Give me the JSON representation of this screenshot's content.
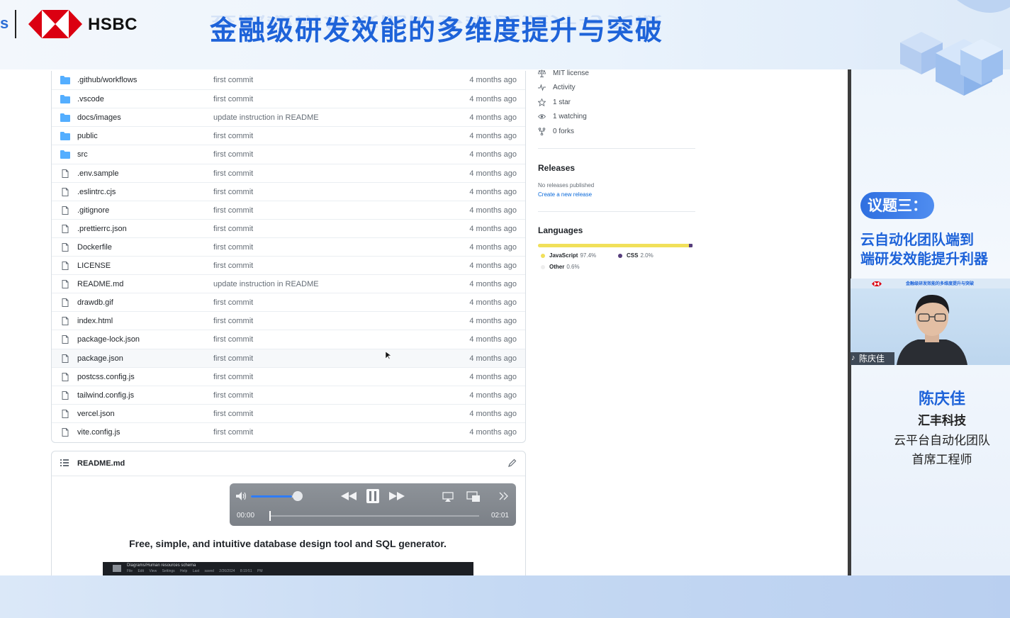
{
  "banner": {
    "edge_glyph": "s",
    "hsbc_name": "HSBC",
    "main_title": "金融级研发效能的多维度提升与突破"
  },
  "file_list": [
    {
      "type": "folder",
      "name": ".github/workflows",
      "message": "first commit",
      "date": "4 months ago"
    },
    {
      "type": "folder",
      "name": ".vscode",
      "message": "first commit",
      "date": "4 months ago"
    },
    {
      "type": "folder",
      "name": "docs/images",
      "message": "update instruction in README",
      "date": "4 months ago"
    },
    {
      "type": "folder",
      "name": "public",
      "message": "first commit",
      "date": "4 months ago"
    },
    {
      "type": "folder",
      "name": "src",
      "message": "first commit",
      "date": "4 months ago"
    },
    {
      "type": "file",
      "name": ".env.sample",
      "message": "first commit",
      "date": "4 months ago"
    },
    {
      "type": "file",
      "name": ".eslintrc.cjs",
      "message": "first commit",
      "date": "4 months ago"
    },
    {
      "type": "file",
      "name": ".gitignore",
      "message": "first commit",
      "date": "4 months ago"
    },
    {
      "type": "file",
      "name": ".prettierrc.json",
      "message": "first commit",
      "date": "4 months ago"
    },
    {
      "type": "file",
      "name": "Dockerfile",
      "message": "first commit",
      "date": "4 months ago"
    },
    {
      "type": "file",
      "name": "LICENSE",
      "message": "first commit",
      "date": "4 months ago"
    },
    {
      "type": "file",
      "name": "README.md",
      "message": "update instruction in README",
      "date": "4 months ago"
    },
    {
      "type": "file",
      "name": "drawdb.gif",
      "message": "first commit",
      "date": "4 months ago"
    },
    {
      "type": "file",
      "name": "index.html",
      "message": "first commit",
      "date": "4 months ago"
    },
    {
      "type": "file",
      "name": "package-lock.json",
      "message": "first commit",
      "date": "4 months ago"
    },
    {
      "type": "file",
      "name": "package.json",
      "message": "first commit",
      "date": "4 months ago"
    },
    {
      "type": "file",
      "name": "postcss.config.js",
      "message": "first commit",
      "date": "4 months ago"
    },
    {
      "type": "file",
      "name": "tailwind.config.js",
      "message": "first commit",
      "date": "4 months ago"
    },
    {
      "type": "file",
      "name": "vercel.json",
      "message": "first commit",
      "date": "4 months ago"
    },
    {
      "type": "file",
      "name": "vite.config.js",
      "message": "first commit",
      "date": "4 months ago"
    }
  ],
  "readme": {
    "title": "README.md",
    "tagline": "Free, simple, and intuitive database design tool and SQL generator.",
    "preview_title": "Diagrams/Human resources schema",
    "preview_menu": "File Edit View Settings Help Last saved 2/26/2024 8:19:51 PM"
  },
  "video": {
    "current_time": "00:00",
    "total_time": "02:01",
    "volume_level": 0.9,
    "progress": 0.0
  },
  "sidebar": {
    "meta": [
      {
        "icon": "scale-icon",
        "label": "MIT license"
      },
      {
        "icon": "pulse-icon",
        "label": "Activity"
      },
      {
        "icon": "star-icon",
        "label": "1 star"
      },
      {
        "icon": "eye-icon",
        "label": "1 watching"
      },
      {
        "icon": "fork-icon",
        "label": "0 forks"
      }
    ],
    "releases": {
      "heading": "Releases",
      "none_text": "No releases published",
      "create_link": "Create a new release"
    },
    "languages": {
      "heading": "Languages",
      "items": [
        {
          "name": "JavaScript",
          "percent": "97.4%",
          "value": 97.4,
          "color": "#f1e05a"
        },
        {
          "name": "CSS",
          "percent": "2.0%",
          "value": 2.0,
          "color": "#563d7c"
        },
        {
          "name": "Other",
          "percent": "0.6%",
          "value": 0.6,
          "color": "#ededed"
        }
      ]
    }
  },
  "speaker_panel": {
    "topic_label": "议题三：",
    "topic_line1": "云自动化团队端到",
    "topic_line2": "端研发效能提升利器",
    "cam_strip_text": "金融级研发效能的多维度提升与突破",
    "cam_name": "陈庆佳",
    "speaker_name": "陈庆佳",
    "company": "汇丰科技",
    "role_line1": "云平台自动化团队",
    "role_line2": "首席工程师"
  },
  "colors": {
    "accent_blue": "#1e63d9",
    "hsbc_red": "#db0011",
    "folder_blue": "#54aeff",
    "link_blue": "#0969da"
  }
}
